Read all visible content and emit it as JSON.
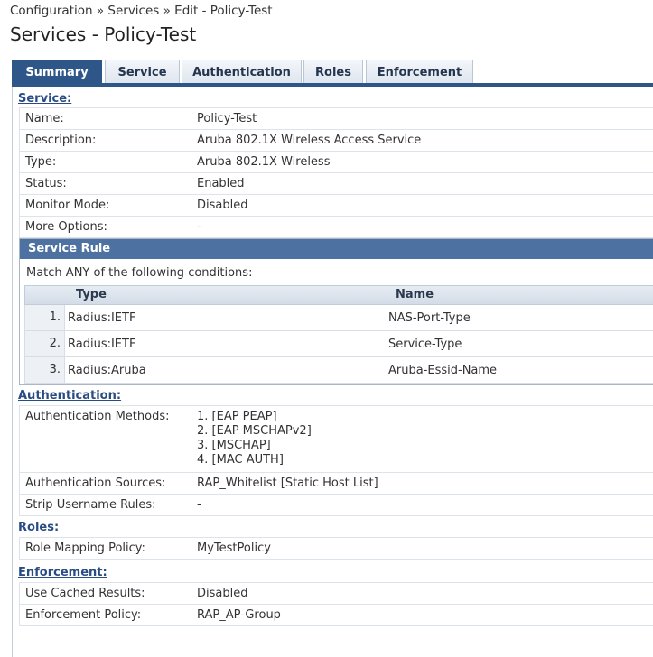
{
  "breadcrumb": "Configuration » Services » Edit - Policy-Test",
  "page_title": "Services - Policy-Test",
  "tabs": [
    {
      "label": "Summary",
      "active": true
    },
    {
      "label": "Service",
      "active": false
    },
    {
      "label": "Authentication",
      "active": false
    },
    {
      "label": "Roles",
      "active": false
    },
    {
      "label": "Enforcement",
      "active": false
    }
  ],
  "service": {
    "heading": "Service:",
    "rows": [
      {
        "label": "Name:",
        "value": "Policy-Test"
      },
      {
        "label": "Description:",
        "value": "Aruba 802.1X Wireless Access Service"
      },
      {
        "label": "Type:",
        "value": "Aruba 802.1X Wireless"
      },
      {
        "label": "Status:",
        "value": "Enabled"
      },
      {
        "label": "Monitor Mode:",
        "value": "Disabled"
      },
      {
        "label": "More Options:",
        "value": "-"
      }
    ]
  },
  "service_rule": {
    "title": "Service Rule",
    "match_text": "Match ANY of the following conditions:",
    "columns": {
      "type": "Type",
      "name": "Name"
    },
    "rows": [
      {
        "num": "1.",
        "type": "Radius:IETF",
        "name": "NAS-Port-Type"
      },
      {
        "num": "2.",
        "type": "Radius:IETF",
        "name": "Service-Type"
      },
      {
        "num": "3.",
        "type": "Radius:Aruba",
        "name": "Aruba-Essid-Name"
      }
    ]
  },
  "authentication": {
    "heading": "Authentication:",
    "methods_label": "Authentication Methods:",
    "methods": [
      "1. [EAP PEAP]",
      "2. [EAP MSCHAPv2]",
      "3. [MSCHAP]",
      "4. [MAC AUTH]"
    ],
    "sources_label": "Authentication Sources:",
    "sources_value": "RAP_Whitelist [Static Host List]",
    "strip_label": "Strip Username Rules:",
    "strip_value": "-"
  },
  "roles": {
    "heading": "Roles:",
    "mapping_label": "Role Mapping Policy:",
    "mapping_value": "MyTestPolicy"
  },
  "enforcement": {
    "heading": "Enforcement:",
    "cached_label": "Use Cached Results:",
    "cached_value": "Disabled",
    "policy_label": "Enforcement Policy:",
    "policy_value": "RAP_AP-Group"
  }
}
